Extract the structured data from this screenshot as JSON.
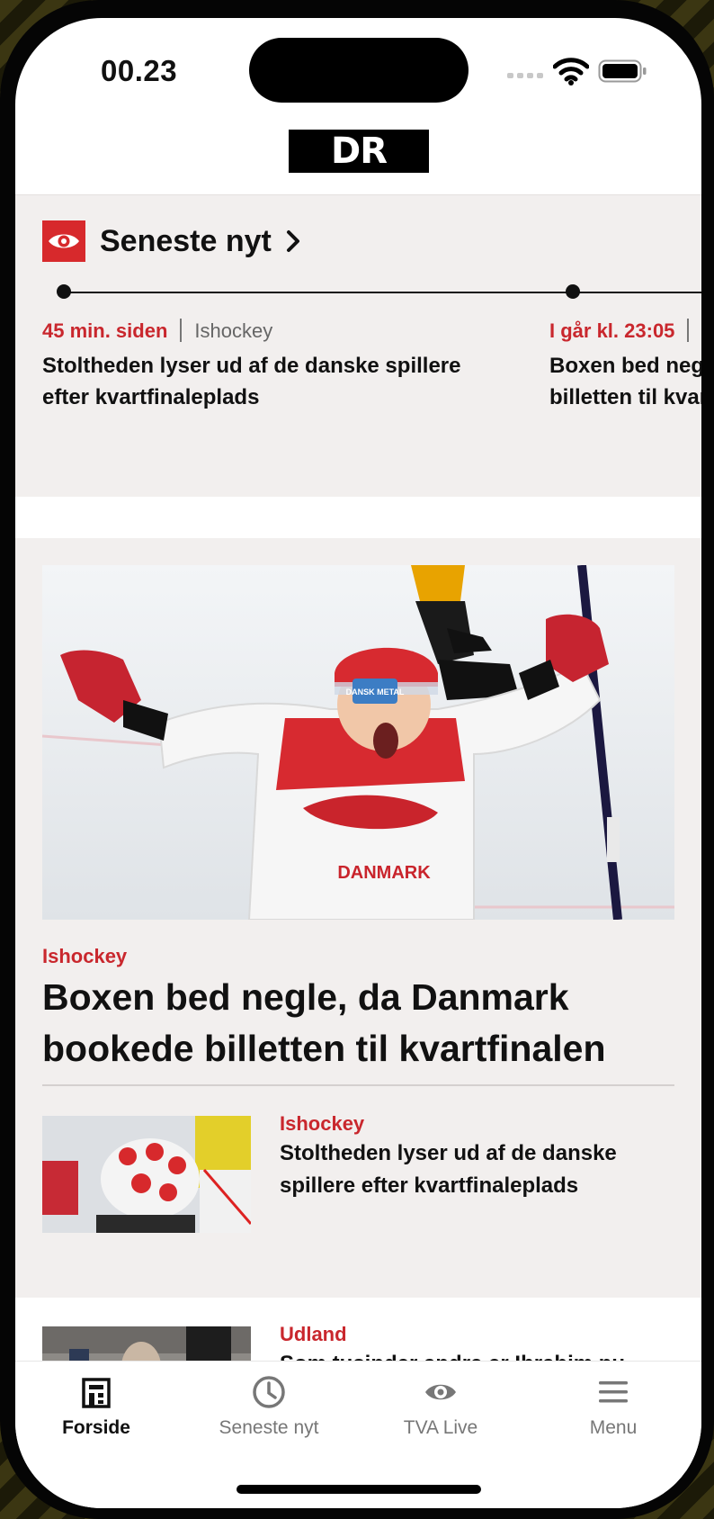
{
  "status_bar": {
    "time": "00.23",
    "icons": [
      "signal-icon",
      "wifi-icon",
      "battery-icon"
    ]
  },
  "header": {
    "logo_text": "DR"
  },
  "latest_news": {
    "title": "Seneste nyt",
    "items": [
      {
        "time": "45 min. siden",
        "category": "Ishockey",
        "headline_line1": "Stoltheden lyser ud af de danske spillere",
        "headline_line2": "efter kvartfinaleplads"
      },
      {
        "time": "I går kl. 23:05",
        "category": "",
        "headline_line1": "Boxen bed negle, da Danmark bookede",
        "headline_line2": "billetten til kvartfinalen"
      }
    ]
  },
  "feature": {
    "category": "Ishockey",
    "title": "Boxen bed negle, da Danmark bookede billetten til kvartfinalen",
    "jersey_text": "DANMARK",
    "helmet_text": "DANSK METAL",
    "sub_article": {
      "category": "Ishockey",
      "title": "Stoltheden lyser ud af de danske spillere efter kvartfinaleplads"
    }
  },
  "next_article": {
    "category": "Udland",
    "title": "Som tusinder andre er Ibrahim nu"
  },
  "tabbar": {
    "tabs": [
      {
        "label": "Forside",
        "icon": "home-icon",
        "active": true
      },
      {
        "label": "Seneste nyt",
        "icon": "clock-icon",
        "active": false
      },
      {
        "label": "TVA Live",
        "icon": "eye-icon",
        "active": false
      },
      {
        "label": "Menu",
        "icon": "hamburger-icon",
        "active": false
      }
    ]
  },
  "colors": {
    "accent_red": "#d7292c",
    "category_red": "#c9272d",
    "panel_bg": "#f2efee"
  }
}
